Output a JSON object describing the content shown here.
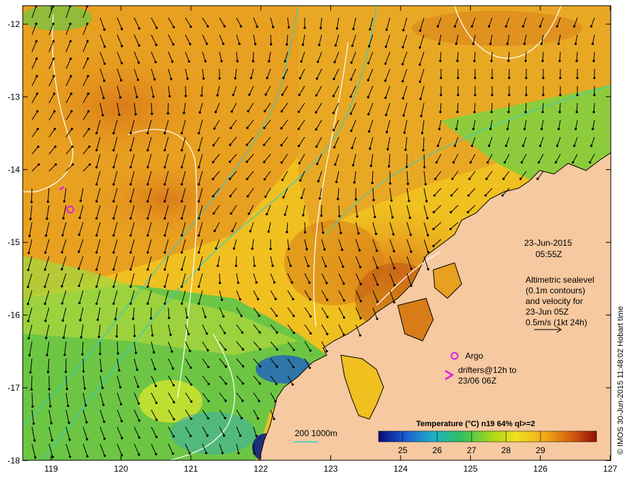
{
  "map": {
    "lon_ticks": [
      "119",
      "120",
      "121",
      "122",
      "123",
      "124",
      "125",
      "126",
      "127"
    ],
    "lat_ticks": [
      "-12",
      "-13",
      "-14",
      "-15",
      "-16",
      "-17",
      "-18"
    ],
    "date": "23-Jun-2015",
    "time": "05:55Z",
    "altimetry_lines": [
      "Altimetric sealevel",
      "(0.1m contours)",
      "and velocity for",
      "23-Jun 05Z",
      "0.5m/s (1kt 24h)"
    ],
    "argo_label": "Argo",
    "drifter_lines": [
      "drifters@12h to",
      "23/06 06Z"
    ],
    "depth_legend": "200  1000m",
    "colorbar_title": "Temperature (°C) n19 64% ql>=2",
    "colorbar_ticks": [
      "25",
      "26",
      "27",
      "28",
      "29"
    ],
    "credit": "© IMOS 30-Jun-2015 11:48:02 Hobart time",
    "colors": {
      "land": "#f6c9a0",
      "ocean_warm": "#e89a1c",
      "ocean_mid": "#f2d21e",
      "ocean_cool": "#5fc84a",
      "argo": "#e020e0",
      "isobath": "#33cccc",
      "contour": "#ffffff"
    }
  }
}
